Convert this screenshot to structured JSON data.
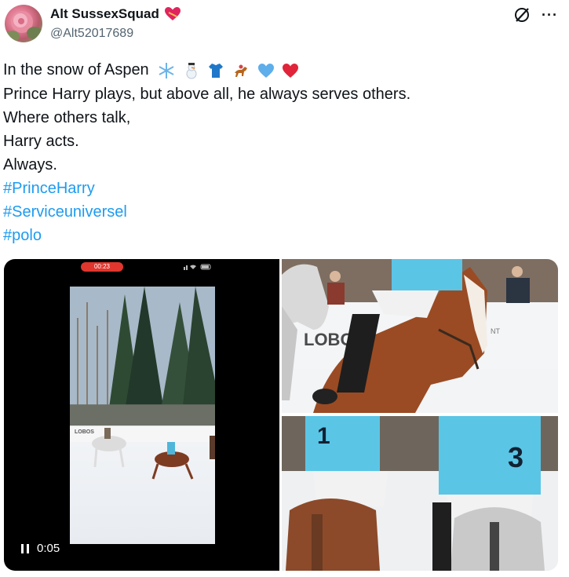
{
  "author": {
    "display_name": "Alt SussexSquad",
    "handle": "@Alt52017689",
    "badge_icon": "heart-with-ribbon-icon"
  },
  "header_actions": {
    "grok_icon": "grok-icon",
    "more_label": "···"
  },
  "post": {
    "lines": [
      "In the snow of Aspen",
      "Prince Harry plays, but above all, he always serves others.",
      "Where others talk,",
      "Harry acts.",
      "Always."
    ],
    "emojis": [
      "snowflake-icon",
      "snowman-icon",
      "tshirt-icon",
      "horse-racing-icon",
      "blue-heart-icon",
      "red-heart-icon"
    ],
    "hashtags": [
      "#PrinceHarry",
      "#Serviceuniversel",
      "#polo"
    ]
  },
  "media": {
    "video": {
      "recording_badge": "00:23",
      "time": "0:05",
      "board_text": "LOBOS"
    },
    "photo_top": {
      "board_text": "LOBOS",
      "board_text_right": "NT"
    },
    "photo_bottom": {
      "jersey_number_left": "1",
      "jersey_number_right": "3"
    }
  },
  "colors": {
    "hashtag": "#1d9bf0",
    "jersey": "#5bc5e6",
    "text": "#0f1419",
    "secondary": "#536471"
  }
}
